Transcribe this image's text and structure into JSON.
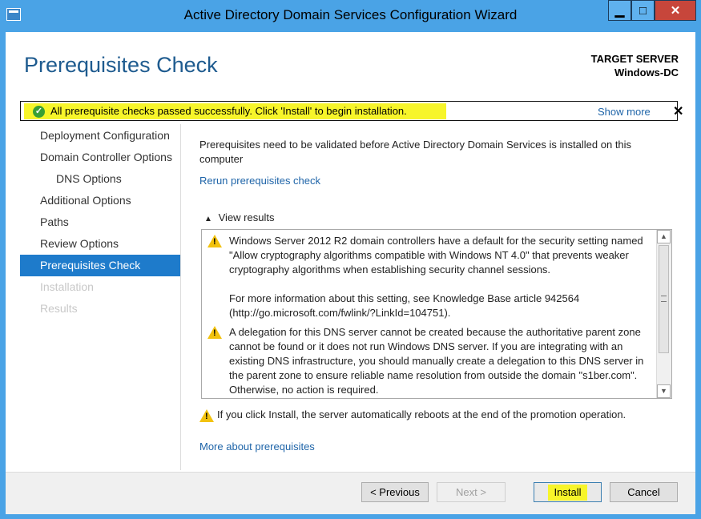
{
  "window": {
    "title": "Active Directory Domain Services Configuration Wizard",
    "controls": {
      "minimize": "▁",
      "maximize": "□",
      "close": "✕"
    }
  },
  "header": {
    "page_title": "Prerequisites Check",
    "target_label": "TARGET SERVER",
    "target_value": "Windows-DC"
  },
  "banner": {
    "icon": "check-circle-icon",
    "message": "All prerequisite checks passed successfully.  Click 'Install' to begin installation.",
    "show_more": "Show more",
    "close": "✕",
    "highlight_color": "#f7f52a"
  },
  "sidebar": {
    "items": [
      {
        "label": "Deployment Configuration",
        "state": "normal"
      },
      {
        "label": "Domain Controller Options",
        "state": "normal"
      },
      {
        "label": "DNS Options",
        "state": "sub"
      },
      {
        "label": "Additional Options",
        "state": "normal"
      },
      {
        "label": "Paths",
        "state": "normal"
      },
      {
        "label": "Review Options",
        "state": "normal"
      },
      {
        "label": "Prerequisites Check",
        "state": "active"
      },
      {
        "label": "Installation",
        "state": "disabled"
      },
      {
        "label": "Results",
        "state": "disabled"
      }
    ]
  },
  "main": {
    "intro": "Prerequisites need to be validated before Active Directory Domain Services is installed on this computer",
    "rerun_link": "Rerun prerequisites check",
    "view_results": "View results",
    "results": [
      {
        "icon": "warning-icon",
        "text": "Windows Server 2012 R2 domain controllers have a default for the security setting named \"Allow cryptography algorithms compatible with Windows NT 4.0\" that prevents weaker cryptography algorithms when establishing security channel sessions.\n\nFor more information about this setting, see Knowledge Base article 942564 (http://go.microsoft.com/fwlink/?LinkId=104751)."
      },
      {
        "icon": "warning-icon",
        "text": "A delegation for this DNS server cannot be created because the authoritative parent zone cannot be found or it does not run Windows DNS server. If you are integrating with an existing DNS infrastructure, you should manually create a delegation to this DNS server in the parent zone to ensure reliable name resolution from outside the domain \"s1ber.com\". Otherwise, no action is required."
      }
    ],
    "reboot_note": "If you click Install, the server automatically reboots at the end of the promotion operation.",
    "more_about_link": "More about prerequisites"
  },
  "footer": {
    "previous": "< Previous",
    "next": "Next >",
    "install": "Install",
    "cancel": "Cancel"
  },
  "colors": {
    "accent": "#1e7bcb",
    "title_blue": "#1e5b8f",
    "link": "#1e64a8",
    "highlight": "#f7f52a",
    "warning": "#f2c20e",
    "success": "#3aa035"
  }
}
